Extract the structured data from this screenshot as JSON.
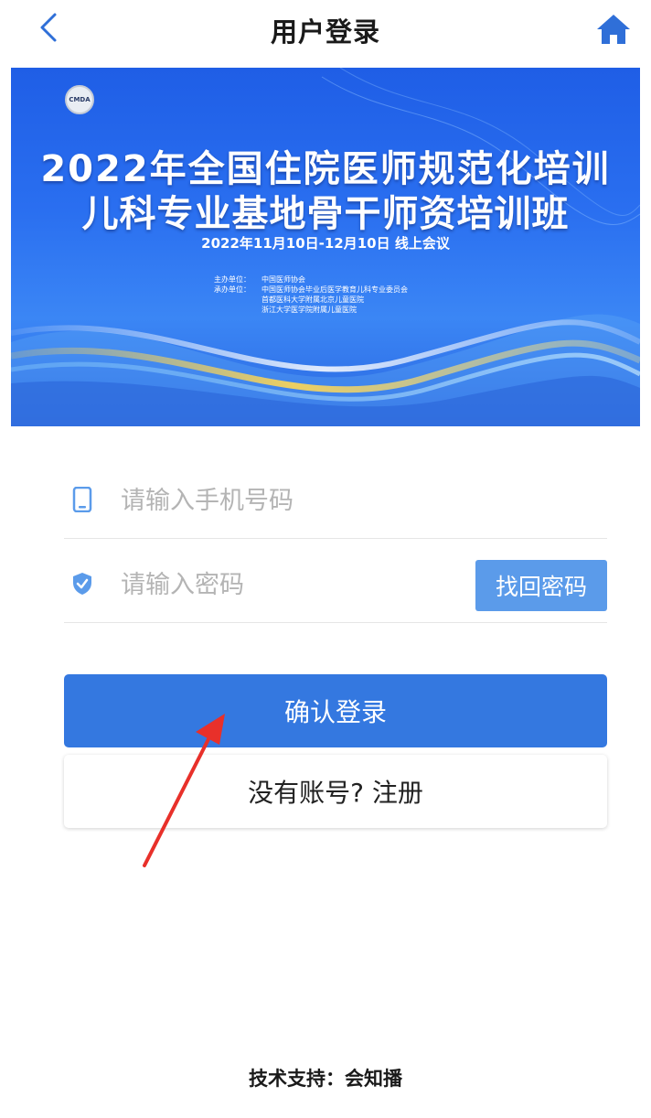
{
  "header": {
    "title": "用户登录",
    "back_icon": "chevron-left-icon",
    "home_icon": "home-icon"
  },
  "banner": {
    "logo_text": "CMDA",
    "title_line1": "2022年全国住院医师规范化培训",
    "title_line2": "儿科专业基地骨干师资培训班",
    "date": "2022年11月10日-12月10日  线上会议",
    "organizers": [
      {
        "label": "主办单位：",
        "value": "中国医师协会"
      },
      {
        "label": "承办单位：",
        "value": "中国医师协会毕业后医学教育儿科专业委员会"
      },
      {
        "label": "",
        "value": "首都医科大学附属北京儿童医院"
      },
      {
        "label": "",
        "value": "浙江大学医学院附属儿童医院"
      }
    ]
  },
  "form": {
    "phone_placeholder": "请输入手机号码",
    "password_placeholder": "请输入密码",
    "find_password_label": "找回密码",
    "login_label": "确认登录",
    "register_label": "没有账号? 注册"
  },
  "footer": {
    "text": "技术支持：会知播"
  },
  "colors": {
    "primary": "#3478e0",
    "find_password_bg": "#5b9bea",
    "icon_blue": "#5b9bea",
    "arrow_red": "#e8302a"
  }
}
